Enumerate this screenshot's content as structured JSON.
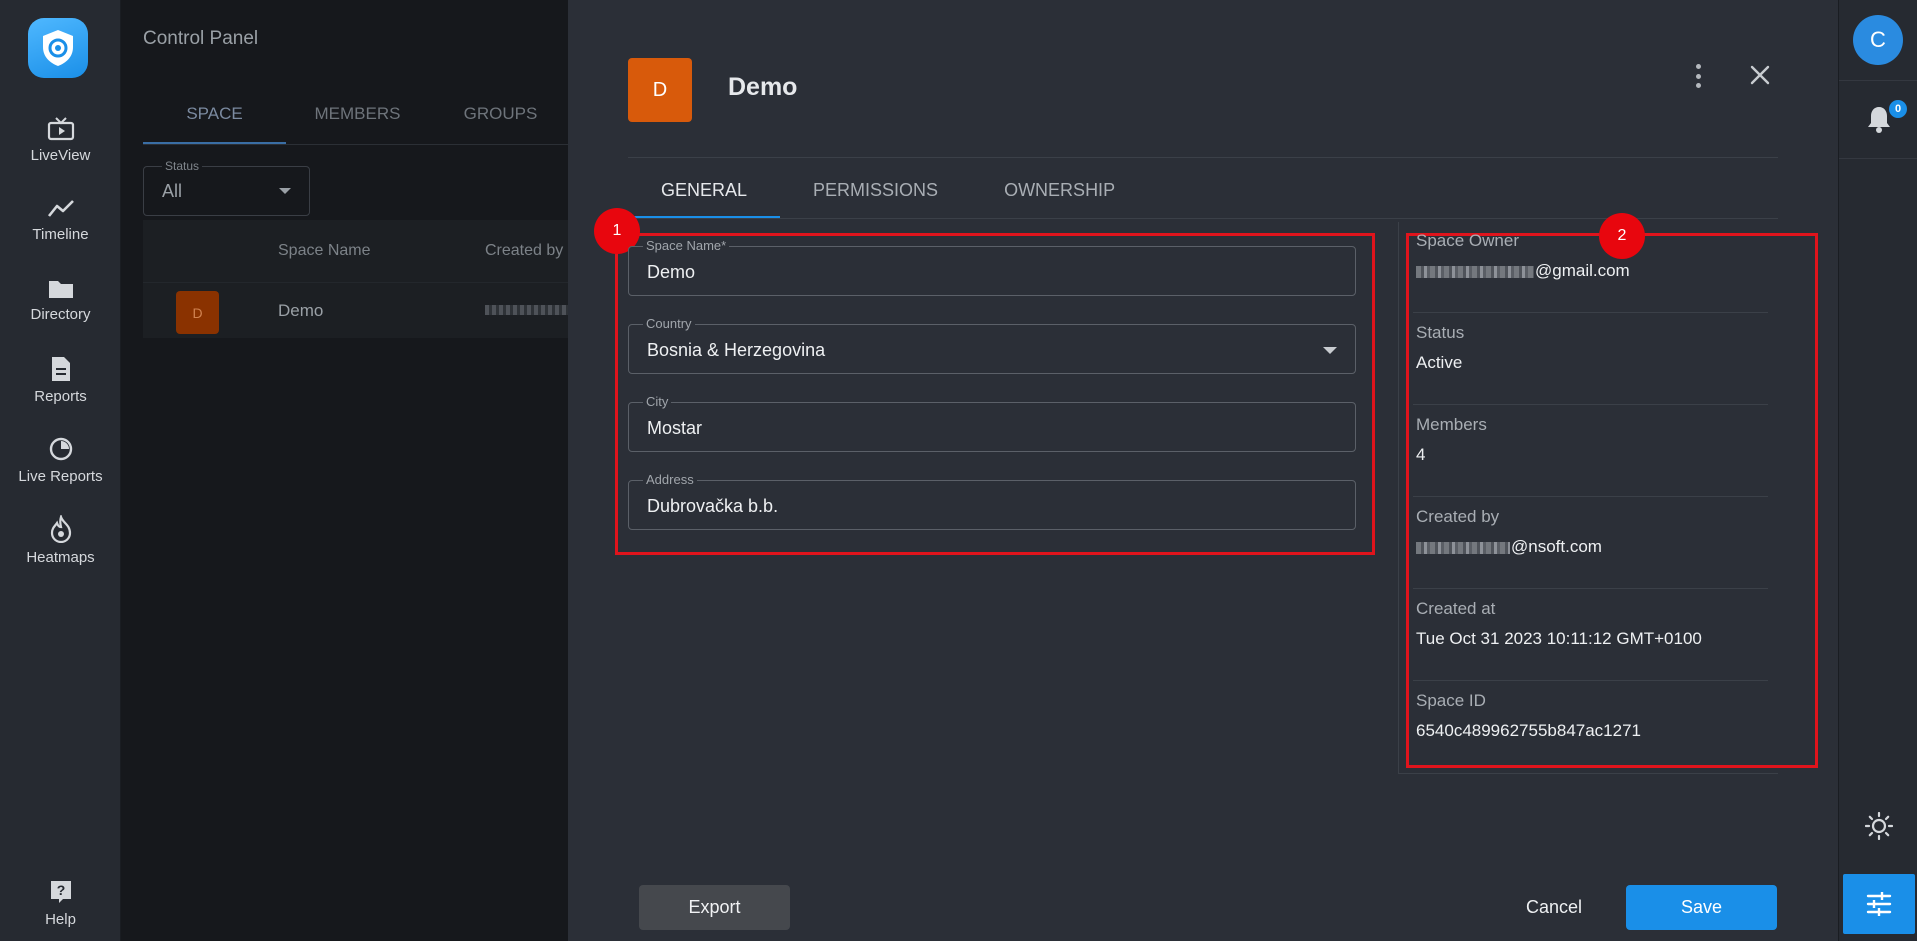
{
  "nav": {
    "items": [
      {
        "label": "LiveView",
        "icon": "tv-icon"
      },
      {
        "label": "Timeline",
        "icon": "timeline-icon"
      },
      {
        "label": "Directory",
        "icon": "folder-icon"
      },
      {
        "label": "Reports",
        "icon": "document-icon"
      },
      {
        "label": "Live Reports",
        "icon": "live-report-icon"
      },
      {
        "label": "Heatmaps",
        "icon": "flame-icon"
      }
    ],
    "help_label": "Help"
  },
  "background": {
    "title": "Control Panel",
    "tabs": [
      "SPACE",
      "MEMBERS",
      "GROUPS"
    ],
    "status_filter": {
      "label": "Status",
      "value": "All"
    },
    "table": {
      "headers": [
        "Space Name",
        "Created by"
      ],
      "rows": [
        {
          "avatar": "D",
          "name": "Demo"
        }
      ]
    }
  },
  "modal": {
    "avatar_letter": "D",
    "title": "Demo",
    "tabs": [
      "GENERAL",
      "PERMISSIONS",
      "OWNERSHIP"
    ],
    "form": {
      "space_name": {
        "label": "Space Name*",
        "value": "Demo"
      },
      "country": {
        "label": "Country",
        "value": "Bosnia & Herzegovina"
      },
      "city": {
        "label": "City",
        "value": "Mostar"
      },
      "address": {
        "label": "Address",
        "value": "Dubrovačka b.b."
      }
    },
    "info": [
      {
        "label": "Space Owner",
        "value": "@gmail.com"
      },
      {
        "label": "Status",
        "value": "Active"
      },
      {
        "label": "Members",
        "value": "4"
      },
      {
        "label": "Created by",
        "value": "@nsoft.com"
      },
      {
        "label": "Created at",
        "value": "Tue Oct 31 2023 10:11:12 GMT+0100"
      },
      {
        "label": "Space ID",
        "value": "6540c489962755b847ac1271"
      }
    ],
    "markers": [
      "1",
      "2"
    ],
    "buttons": {
      "export": "Export",
      "cancel": "Cancel",
      "save": "Save"
    }
  },
  "rightbar": {
    "user_initial": "C",
    "notification_count": "0"
  },
  "colors": {
    "accent": "#1a8fe8",
    "space_avatar": "#d85a0b",
    "highlight_marker": "#e0141c"
  }
}
